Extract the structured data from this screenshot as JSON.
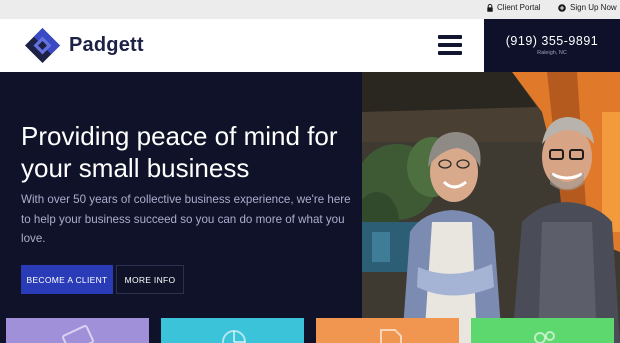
{
  "utility_bar": {
    "client_portal": "Client Portal",
    "sign_up": "Sign Up Now"
  },
  "header": {
    "brand": "Padgett",
    "phone": "(919) 355-9891",
    "location": "Raleigh, NC"
  },
  "hero": {
    "title": "Providing peace of mind for your small business",
    "text": "With over 50 years of collective business experience, we're here to help your business succeed so you can do more of what you love.",
    "primary_button": "BECOME A CLIENT",
    "secondary_button": "MORE INFO"
  },
  "tiles": [
    {
      "icon": "card-icon",
      "color": "#a08fd9"
    },
    {
      "icon": "pie-chart-icon",
      "color": "#3ac3d9"
    },
    {
      "icon": "document-icon",
      "color": "#f09650"
    },
    {
      "icon": "people-icon",
      "color": "#5cd86e"
    }
  ],
  "colors": {
    "brand_navy": "#1c2145",
    "hero_background": "#0f1228",
    "button_blue": "#2a3bb8"
  }
}
